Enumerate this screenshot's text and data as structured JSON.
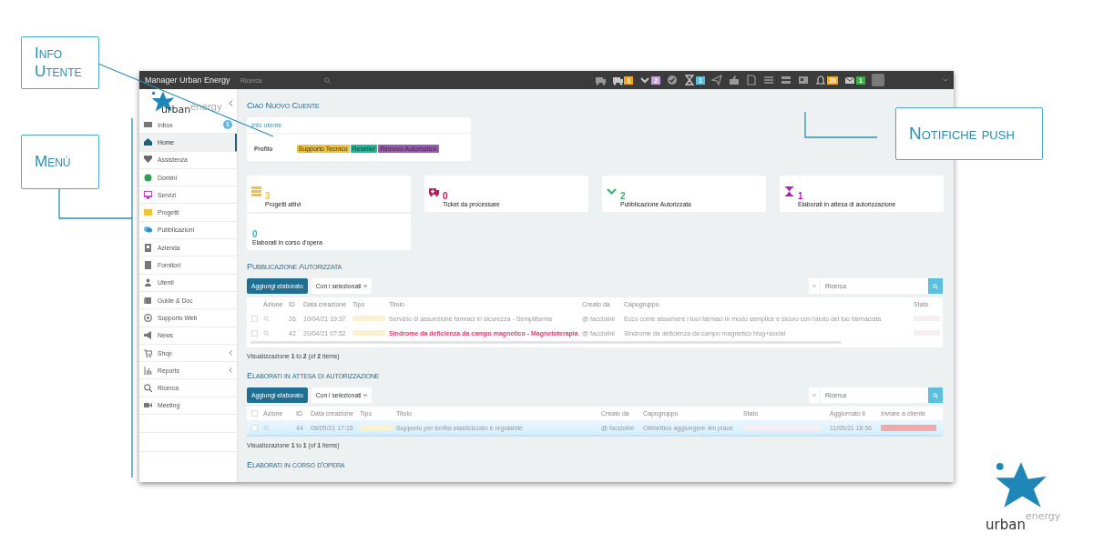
{
  "annotations": [
    {
      "label": "Info Utente"
    },
    {
      "label": "Menú"
    },
    {
      "label": "Notifiche push"
    }
  ],
  "app": {
    "title": "Manager Urban Energy",
    "search": {
      "placeholder": "Ricerca"
    },
    "notifications": [
      {
        "unread": false
      },
      {
        "unread": true,
        "badge": "1",
        "color": "#f5a623"
      },
      {
        "unread": true,
        "badge": "2",
        "color": "#c9a0dc"
      },
      {
        "unread": false
      },
      {
        "unread": true,
        "badge": "1",
        "color": "#5bc0de"
      },
      {
        "unread": false
      },
      {
        "unread": false
      },
      {
        "unread": false
      },
      {
        "unread": false
      },
      {
        "unread": false
      },
      {
        "unread": false
      },
      {
        "unread": true,
        "badge": "20",
        "color": "#f5a623"
      },
      {
        "unread": true,
        "badge": "1",
        "color": "#3cb043"
      }
    ]
  },
  "sidebar": {
    "logo": {
      "main": "urban",
      "accent": "energy"
    },
    "items": [
      {
        "label": "Inbox",
        "badge": "1",
        "selected": false,
        "submenu": false
      },
      {
        "label": "Home",
        "selected": true,
        "submenu": false
      },
      {
        "label": "Assistenza",
        "selected": false,
        "submenu": false
      },
      {
        "label": "Domini",
        "selected": false,
        "submenu": false
      },
      {
        "label": "Servizi",
        "selected": false,
        "submenu": false
      },
      {
        "label": "Progetti",
        "selected": false,
        "submenu": false
      },
      {
        "label": "Pubblicazioni",
        "selected": false,
        "submenu": false
      },
      {
        "label": "Azienda",
        "selected": false,
        "submenu": false
      },
      {
        "label": "Fornitori",
        "selected": false,
        "submenu": false
      },
      {
        "label": "Utenti",
        "selected": false,
        "submenu": false
      },
      {
        "label": "Guide & Doc",
        "selected": false,
        "submenu": false
      },
      {
        "label": "Supporto Web",
        "selected": false,
        "submenu": false
      },
      {
        "label": "News",
        "selected": false,
        "submenu": false
      },
      {
        "label": "Shop",
        "selected": false,
        "submenu": true
      },
      {
        "label": "Reports",
        "selected": false,
        "submenu": true
      },
      {
        "label": "Ricerca",
        "selected": false,
        "submenu": false
      },
      {
        "label": "Meeting",
        "selected": false,
        "submenu": false
      }
    ]
  },
  "brand_logo": {
    "main": "urban",
    "accent": "energy"
  },
  "greeting": "Ciao Nuovo Cliente",
  "info_card": {
    "title": "Info utente",
    "profile_label": "Profilo",
    "tags": [
      {
        "label": "Supporto Tecnico",
        "color": "#f0c23b"
      },
      {
        "label": "Reseller",
        "color": "#1abc9c"
      },
      {
        "label": "Rinnovo Automatico",
        "color": "#9b59b6"
      }
    ]
  },
  "stats": [
    {
      "count": "3",
      "label": "Progetti attivi",
      "color": "#f0c23b"
    },
    {
      "count": "0",
      "label": "Ticket da processare",
      "color": "#c0185a"
    },
    {
      "count": "2",
      "label": "Pubblicazione Autorizzata",
      "color": "#3cb371"
    },
    {
      "count": "1",
      "label": "Elaborati in attesa di autorizzazione",
      "color": "#c010c0"
    },
    {
      "count": "0",
      "label": "Elaborati in corso d'opera",
      "color": "#3ab0e0"
    }
  ],
  "sections": [
    {
      "title": "Pubblicazione Autorizzata",
      "add_button": "Aggiungi elaborato",
      "bulk_button": "Con i selezionati",
      "search": {
        "placeholder": "Ricerca"
      },
      "table": {
        "columns": [
          "Azione",
          "ID",
          "Data creazione",
          "Tipo",
          "Titolo",
          "Creato da",
          "Capogruppo",
          "Stato"
        ],
        "rows": [
          {
            "selected": false,
            "highlighted": false,
            "id": "26",
            "date": "10/04/21 19:37",
            "title": "Servizio di assunzione farmaci in sicurezza - Semplifarma",
            "author": "@ facciolini",
            "group": "Ecco come assumere i tuoi farmaci in modo semplice e sicuro con l'aiuto del tuo farmacista"
          },
          {
            "selected": false,
            "highlighted": true,
            "id": "42",
            "date": "20/04/21 07:52",
            "title": "Sindrome da deficienza da campo magnetico - Magnetoterapia",
            "author": "@ facciolini",
            "group": "Sindrome da deficienza da campo magnetico blog+social"
          }
        ]
      },
      "footer": "Visualizzazione **1** to **2** (of **2** items)"
    },
    {
      "title": "Elaborati in attesa di autorizzazione",
      "add_button": "Aggiungi elaborato",
      "bulk_button": "Con i selezionati",
      "search": {
        "placeholder": "Ricerca"
      },
      "table": {
        "all_checked": false,
        "columns": [
          "Azione",
          "ID",
          "Data creazione",
          "Tipo",
          "Titolo",
          "Creato da",
          "Capogruppo",
          "Stato",
          "Aggiornato il",
          "Inviare a cliente"
        ],
        "rows": [
          {
            "selected": true,
            "highlighted": false,
            "id": "44",
            "date": "08/05/21 17:15",
            "title": "Supporto per tonfisi elasticizzato e regolabile",
            "author": "@ facciolini",
            "group": "Obbiettivo aggiungere 4m piace",
            "updated": "11/05/21 18:56"
          }
        ]
      },
      "footer": "Visualizzazione **1** to **1** (of **1** items)"
    },
    {
      "title": "Elaborati in corso d'opera"
    }
  ]
}
